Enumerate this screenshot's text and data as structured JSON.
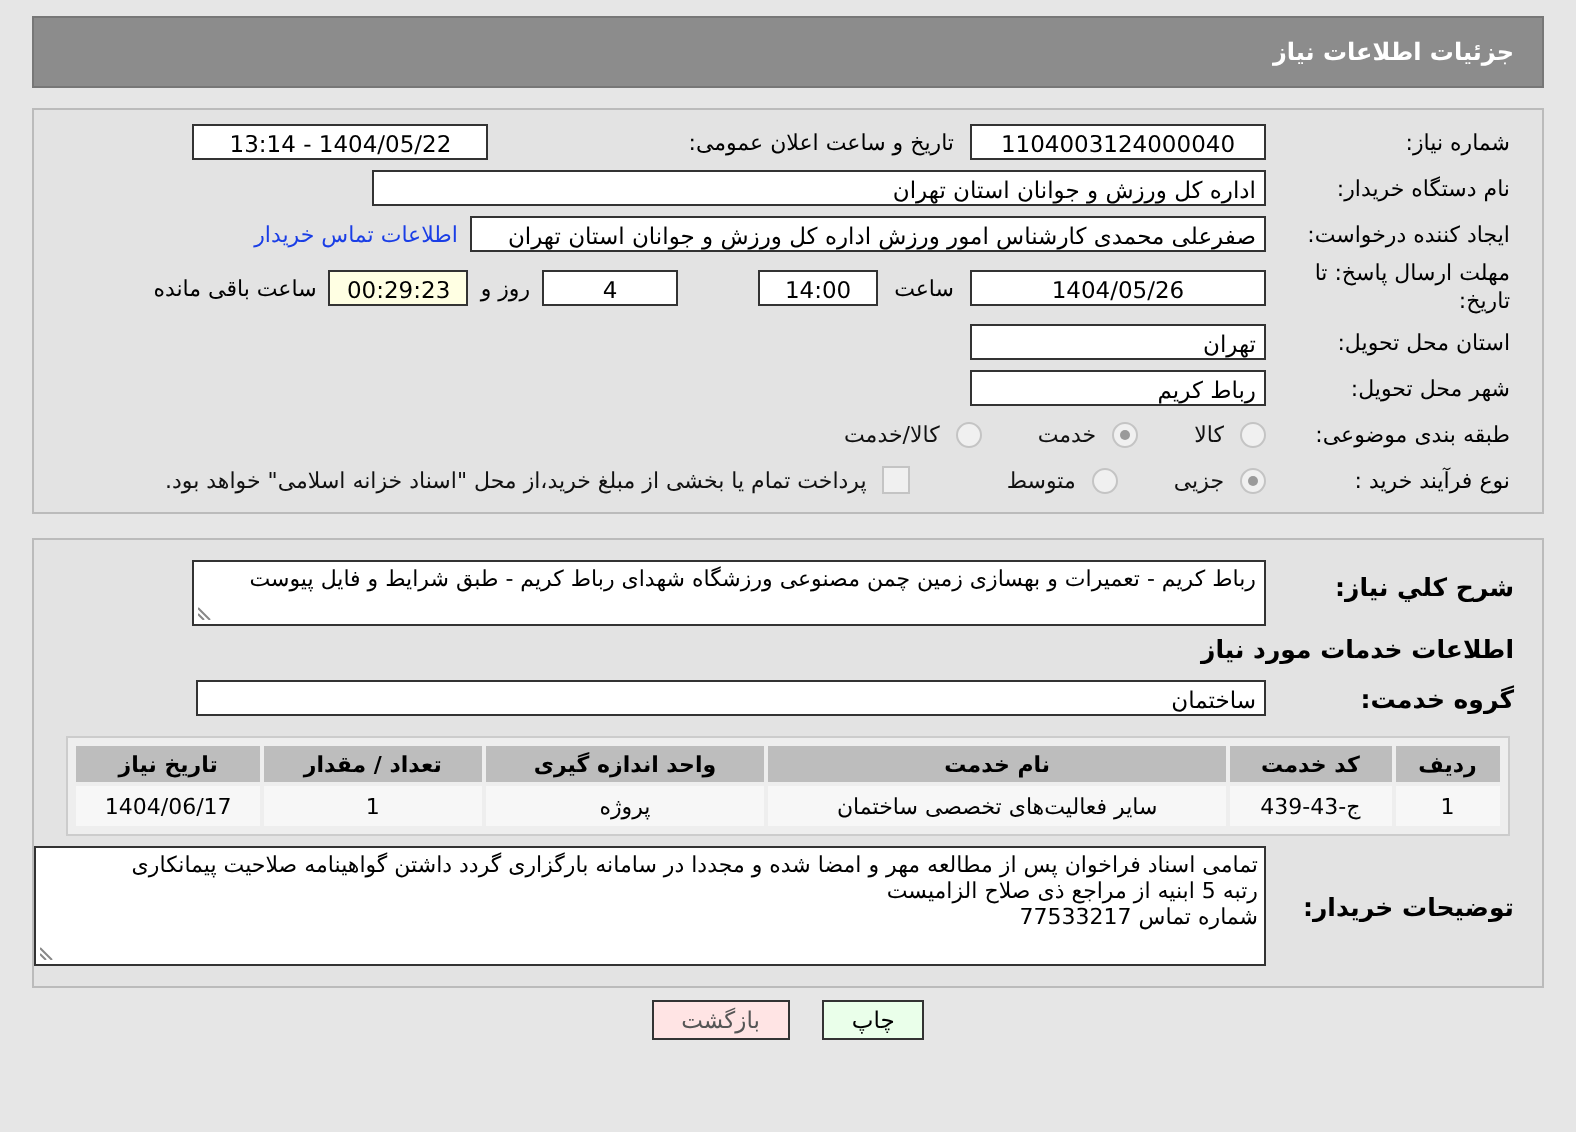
{
  "header": {
    "title": "جزئیات اطلاعات نیاز"
  },
  "need_number": {
    "label": "شماره نیاز:",
    "value": "1104003124000040"
  },
  "announce_datetime": {
    "label": "تاریخ و ساعت اعلان عمومی:",
    "value": "1404/05/22 - 13:14"
  },
  "buyer_org": {
    "label": "نام دستگاه خریدار:",
    "value": "اداره کل ورزش و جوانان استان تهران"
  },
  "requester": {
    "label": "ایجاد کننده درخواست:",
    "value": "صفرعلی محمدی کارشناس امور ورزش اداره کل ورزش و جوانان استان تهران",
    "link": "اطلاعات تماس خریدار"
  },
  "deadline": {
    "label": "مهلت ارسال پاسخ: تا تاریخ:",
    "date": "1404/05/26",
    "time_label": "ساعت",
    "time": "14:00",
    "days": "4",
    "days_label": "روز و",
    "remaining": "00:29:23",
    "remaining_label": "ساعت باقی مانده"
  },
  "province": {
    "label": "استان محل تحویل:",
    "value": "تهران"
  },
  "city": {
    "label": "شهر محل تحویل:",
    "value": "رباط کریم"
  },
  "category": {
    "label": "طبقه بندی موضوعی:",
    "options": [
      {
        "label": "کالا",
        "selected": false
      },
      {
        "label": "خدمت",
        "selected": true
      },
      {
        "label": "کالا/خدمت",
        "selected": false
      }
    ]
  },
  "process_type": {
    "label": "نوع فرآیند خرید :",
    "options": [
      {
        "label": "جزیی",
        "selected": true
      },
      {
        "label": "متوسط",
        "selected": false
      }
    ],
    "payment_checkbox": {
      "label": "پرداخت تمام یا بخشی از مبلغ خرید،از محل \"اسناد خزانه اسلامی\" خواهد بود.",
      "checked": false
    }
  },
  "description": {
    "label": "شرح کلي نياز:",
    "value": "رباط کریم - تعمیرات و بهسازی زمین چمن مصنوعی ورزشگاه شهدای رباط کریم - طبق شرایط و فایل پیوست"
  },
  "services_heading": "اطلاعات خدمات مورد نیاز",
  "service_group": {
    "label": "گروه خدمت:",
    "value": "ساختمان"
  },
  "table": {
    "columns": [
      "ردیف",
      "کد خدمت",
      "نام خدمت",
      "واحد اندازه گیری",
      "تعداد / مقدار",
      "تاریخ نیاز"
    ],
    "rows": [
      [
        "1",
        "ج-43-439",
        "سایر فعالیت‌های تخصصی ساختمان",
        "پروژه",
        "1",
        "1404/06/17"
      ]
    ]
  },
  "buyer_notes": {
    "label": "توضیحات خریدار:",
    "lines": [
      "تمامی اسناد فراخوان پس از مطالعه مهر و امضا شده و مجددا در سامانه بارگزاری گردد داشتن گواهینامه صلاحیت پیمانکاری",
      "رتبه 5 ابنیه از مراجع ذی صلاح  الزامیست",
      "شماره تماس  77533217"
    ]
  },
  "buttons": [
    {
      "label": "چاپ",
      "kind": "print"
    },
    {
      "label": "بازگشت",
      "kind": "back"
    }
  ]
}
